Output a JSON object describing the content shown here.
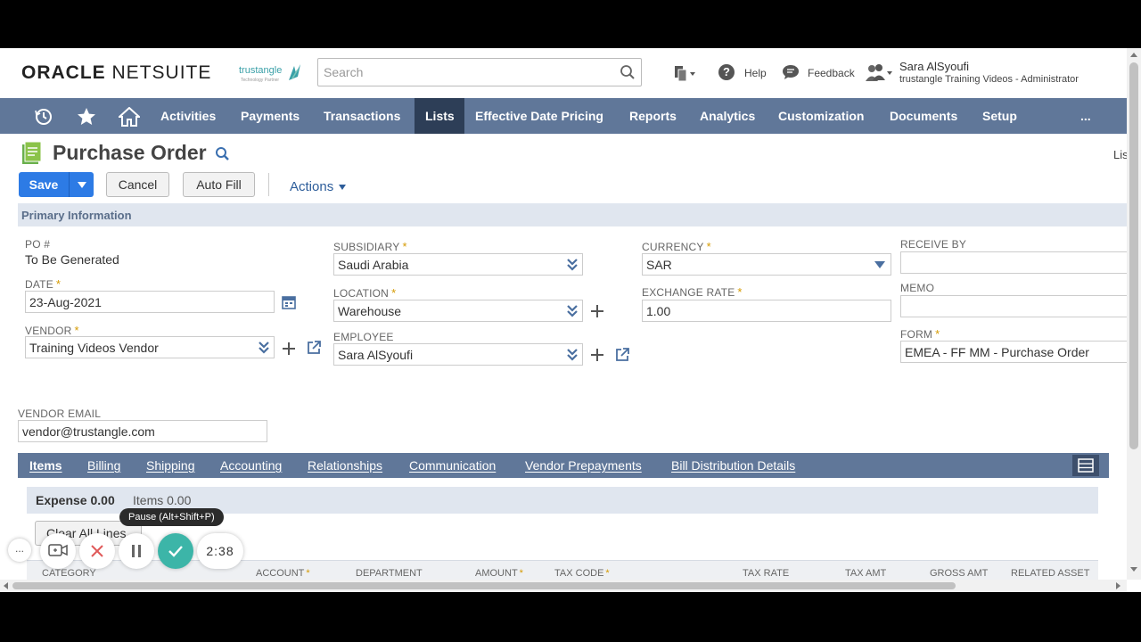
{
  "header": {
    "logo_bold": "ORACLE",
    "logo_light": "NETSUITE",
    "brand_name": "trustangle",
    "brand_sub": "Technology Partner",
    "search_placeholder": "Search",
    "help_label": "Help",
    "feedback_label": "Feedback",
    "user_name": "Sara AlSyoufi",
    "user_role": "trustangle Training Videos - Administrator"
  },
  "nav": {
    "items": [
      "Activities",
      "Payments",
      "Transactions",
      "Lists",
      "Effective Date Pricing",
      "Reports",
      "Analytics",
      "Customization",
      "Documents",
      "Setup"
    ],
    "active": "Lists",
    "more": "..."
  },
  "page": {
    "title": "Purchase Order",
    "cutoff_link": "Lis"
  },
  "toolbar": {
    "save_label": "Save",
    "cancel_label": "Cancel",
    "autofill_label": "Auto Fill",
    "actions_label": "Actions"
  },
  "section": {
    "title": "Primary Information"
  },
  "fields": {
    "po_label": "PO #",
    "po_value": "To Be Generated",
    "date_label": "DATE",
    "date_value": "23-Aug-2021",
    "vendor_label": "VENDOR",
    "vendor_value": "Training Videos Vendor",
    "vendor_email_label": "VENDOR EMAIL",
    "vendor_email_value": "vendor@trustangle.com",
    "subsidiary_label": "SUBSIDIARY",
    "subsidiary_value": "Saudi Arabia",
    "location_label": "LOCATION",
    "location_value": "Warehouse",
    "employee_label": "EMPLOYEE",
    "employee_value": "Sara AlSyoufi",
    "currency_label": "CURRENCY",
    "currency_value": "SAR",
    "exchange_rate_label": "EXCHANGE RATE",
    "exchange_rate_value": "1.00",
    "receive_by_label": "RECEIVE BY",
    "receive_by_value": "",
    "memo_label": "MEMO",
    "memo_value": "",
    "form_label": "FORM",
    "form_value": "EMEA - FF MM - Purchase Order",
    "required_mark": "*"
  },
  "subtabs": {
    "items": [
      "Items",
      "Billing",
      "Shipping",
      "Accounting",
      "Relationships",
      "Communication",
      "Vendor Prepayments",
      "Bill Distribution Details"
    ],
    "active": "Items"
  },
  "subpanel": {
    "expense_label": "Expense 0.00",
    "items_label": "Items 0.00",
    "clear_label": "Clear All Lines"
  },
  "table": {
    "headers": [
      "CATEGORY",
      "ACCOUNT",
      "DEPARTMENT",
      "AMOUNT",
      "TAX CODE",
      "TAX RATE",
      "TAX AMT",
      "GROSS AMT",
      "RELATED ASSET"
    ]
  },
  "recorder": {
    "tooltip": "Pause (Alt+Shift+P)",
    "more": "...",
    "time": "2:38"
  },
  "colors": {
    "nav_bg": "#607799",
    "nav_active": "#2d3e57",
    "save_blue": "#2d7be5",
    "required": "#d59a00",
    "section_bg": "#e0e6ef",
    "recorder_check": "#3cb5a8"
  }
}
